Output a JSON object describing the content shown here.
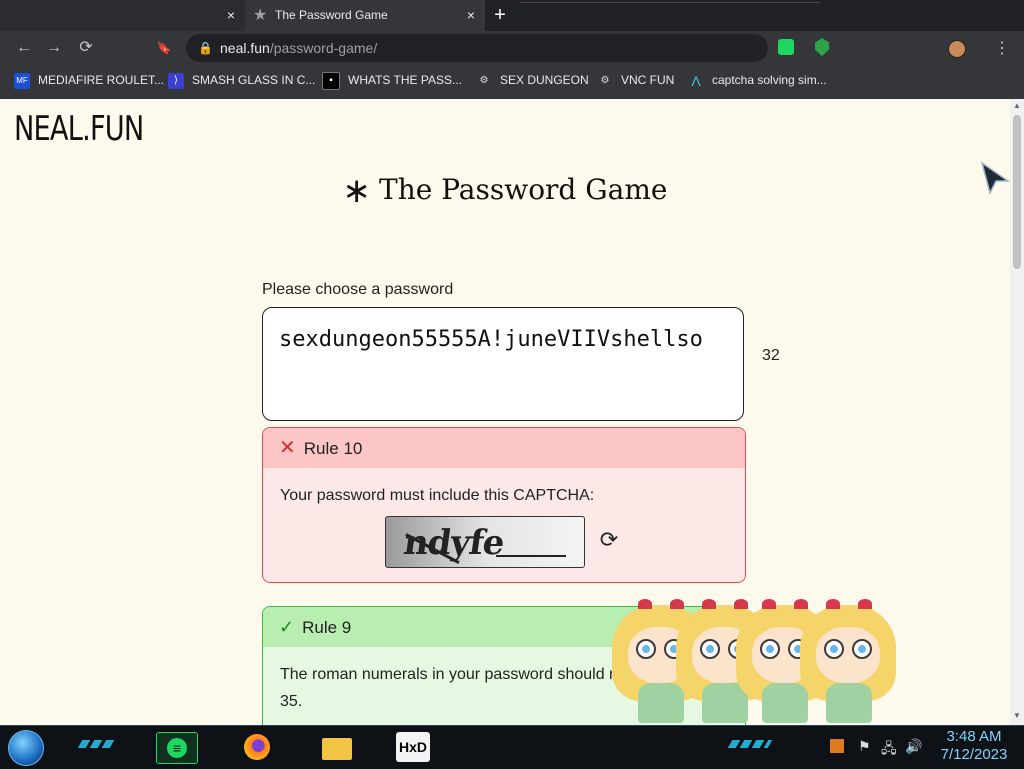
{
  "browser": {
    "tabs": [
      {
        "title": "",
        "close_glyph": "×"
      },
      {
        "title": "The Password Game",
        "close_glyph": "×",
        "favicon_glyph": "★"
      }
    ],
    "new_tab_glyph": "+",
    "url_host": "neal.fun",
    "url_path": "/password-game/",
    "nav": {
      "back": "←",
      "forward": "→",
      "reload": "⟳",
      "bookmark": "🔖",
      "lock": "🔒",
      "menu": "⋮"
    },
    "bookmarks": [
      {
        "label": "MEDIAFIRE ROULET...",
        "icon": "MF",
        "icon_color": "#1a4fd6"
      },
      {
        "label": "SMASH GLASS IN C...",
        "icon": "⟩",
        "icon_color": "#3b3fd1"
      },
      {
        "label": "WHATS THE PASS...",
        "icon": "▪",
        "icon_color": "#000000"
      },
      {
        "label": "SEX DUNGEON",
        "icon": "⚙",
        "icon_color": "#555555"
      },
      {
        "label": "VNC FUN",
        "icon": "⚙",
        "icon_color": "#555555"
      },
      {
        "label": "captcha solving sim...",
        "icon": "Λ",
        "icon_color": "#1b9bb0"
      }
    ]
  },
  "page": {
    "logo": "NEAL.FUN",
    "title_star": "∗",
    "title": "The Password Game",
    "prompt": "Please choose a password",
    "password": "sexdungeon55555A!juneVIIVshellso",
    "char_count": "32",
    "rules": [
      {
        "status": "failed",
        "status_glyph": "✕",
        "title": "Rule 10",
        "text": "Your password must include this CAPTCHA:",
        "captcha_text": "ndyfe",
        "refresh_glyph": "⟳"
      },
      {
        "status": "passed",
        "status_glyph": "✓",
        "title": "Rule 9",
        "text": "The roman numerals in your password should multiply to 35."
      }
    ]
  },
  "taskbar": {
    "apps": [
      "spotify-icon",
      "firefox-icon",
      "file-explorer-icon",
      "hxd-icon"
    ],
    "hxd_label": "HxD",
    "tray": {
      "flag": "⚑",
      "network": "🖧",
      "volume": "🔊"
    },
    "time": "3:48 AM",
    "date": "7/12/2023"
  },
  "colors": {
    "page_bg": "#fdf9ed",
    "rule_fail_border": "#e74c4c",
    "rule_fail_header": "#fcc6c6",
    "rule_pass_border": "#3cb84a",
    "rule_pass_header": "#b8eeb0"
  }
}
